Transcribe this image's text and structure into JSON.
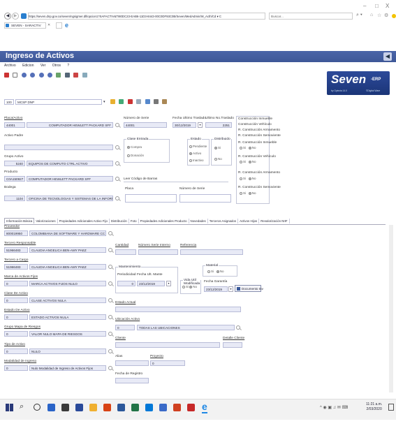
{
  "browser": {
    "address": "https://seven.dnp.gov.co/seven/ngsigmer.dll/opcion1?SAFACTIV&TI80DC23-EAB6-11D3-8443-00C0DF93C0B/Seven/MedAdmin/W_Acth/Cd ▾ C",
    "search_placeholder": "Buscar...",
    "tab_label": "SEVEN - SARACTIV",
    "window_min": "–",
    "window_max": "□",
    "window_close": "X"
  },
  "app": {
    "title": "Ingreso de Activos",
    "menu": [
      "Archivo",
      "Edicion",
      "Ver",
      "Otros",
      "?"
    ],
    "logo": "Seven",
    "logo_suffix": "-ERP",
    "logo_sub": "by Oytezia 14.0",
    "logo_brand": "©Digital Ware"
  },
  "toolbar2": {
    "code": "100",
    "name": "MCSP DNP"
  },
  "header": {
    "placa_label": "Placa/Activo",
    "placa_code": "44001",
    "placa_desc": "COMPUTADOR HEWLETT PACKARD SFF",
    "serie_label": "Número de Serie",
    "serie_value": "44001",
    "fecha_label": "Fecha Ultimo Traslado",
    "fecha_value": "30/12/2019",
    "ultimo_label": "Ultimo No.Traslado",
    "ultimo_value": "2251",
    "padre_label": "Activo Padre",
    "clase_entrada": "Clase Entrada",
    "compra": "Compra",
    "donacion": "Donación",
    "estado": "Estado",
    "pendiente": "Pendiente",
    "activo": "Activo",
    "inactivo": "Inactivo",
    "distribuido": "Distribuido",
    "si": "Si",
    "no": "No",
    "grupo_label": "Grupo Activo",
    "grupo_code": "5240",
    "grupo_desc": "EQUIPOS DE COMPUTO CTRL ACTIVO",
    "producto_label": "Producto",
    "producto_code": "C0A150927",
    "producto_desc": "COMPUTADOR HEWLETT PACKARD SFF",
    "bodega_label": "Bodega",
    "bodega_code": "1104",
    "bodega_desc": "OFICINA DE TECNOLOGIAS Y SISTEMAS DE LA INFORMAC",
    "leer_label": "Leer Código de Barras",
    "placa2_label": "Placa",
    "serie2_label": "Número de Serie",
    "construcciones": [
      "Construcción Inmueble",
      "Construcción Vehículo",
      "R. Construcción Armamento",
      "R. Construcción Semoviente",
      "R. Construcción Inmueble",
      "R. Construcción Vehículo",
      "R. Construcción Armamento",
      "R. Construcción Semoviente"
    ]
  },
  "tabs": [
    "Información Básica",
    "Valorizaciones",
    "Propiedades Adicionales Activo Fijo",
    "Distribución",
    "Foto",
    "Propiedades Adicionales Producto",
    "Novedades",
    "Terceros Asignados",
    "Activos Hijos",
    "Revalorización NIIF"
  ],
  "left": [
    {
      "label": "Proveedor",
      "code": "800019950",
      "desc": "COLOMBIANA DE SOFTWARE Y HARDWARE CC"
    },
    {
      "label": "Tercero Responsable",
      "code": "51966483",
      "desc": "CLAUDIA ANGELICA BEN-AMY PAEZ"
    },
    {
      "label": "Tercero a Cargo",
      "code": "51966483",
      "desc": "CLAUDIA ANGELICA BEN-AMY PAEZ"
    },
    {
      "label": "Marca de Activos Fijos",
      "code": "0",
      "desc": "MARCA ACTIVOS FIJOS NULO"
    },
    {
      "label": "Clase De Activo",
      "code": "0",
      "desc": "CLASE ACTIVOS NULA"
    },
    {
      "label": "Estado De Activo",
      "code": "0",
      "desc": "ESTADO ACTIVOS NULA"
    },
    {
      "label": "Grupo Mapa de Riesgos",
      "code": "0",
      "desc": "VALOR NULO MAPA DE RIESGOS"
    },
    {
      "label": "Tipo de Activo",
      "code": "0",
      "desc": "NULO"
    },
    {
      "label": "Modalidad de Ingreso",
      "code": "0",
      "desc": "Nulo Modalidad de Ingreso de Activos Fijos"
    }
  ],
  "right": {
    "cantidad": "Cantidad",
    "num_serie": "Número Serie Interno",
    "referencia": "Referencia",
    "mantenimiento": "Mantenimiento",
    "periodicidad": "Periodicidad",
    "periodicidad_value": "0",
    "fecha_ult": "Fecha Ult. Mante",
    "fecha_ult_value": "23/12/2019",
    "vida": "Vida Util Modificada",
    "vida_si": "Si",
    "vida_no": "No",
    "garantia": "Fecha Garantía",
    "garantia_value": "23/12/2019",
    "documento": "Documento Inv",
    "material": "Material",
    "mat_si": "Si",
    "mat_no": "No",
    "estado_actual": "Estado Actual",
    "ubicacion": "Ubicación Activo",
    "ubic_code": "0",
    "ubic_desc": "TODAS LAS UBICACIONES",
    "cliente": "Cliente",
    "detalle": "Detalle Cliente",
    "alias": "Alias",
    "proyecto": "Proyecto",
    "proyecto_value": "0",
    "fecha_registro": "Fecha de Registro"
  },
  "taskbar": {
    "time": "11:21 a.m.",
    "date": "2/03/2020"
  }
}
